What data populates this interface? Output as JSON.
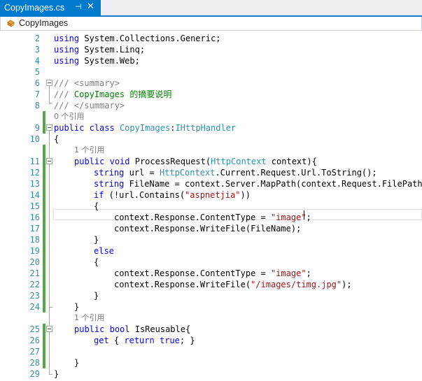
{
  "tab": {
    "title": "CopyImages.cs",
    "pin_icon": "pin-icon",
    "close_icon": "close-icon"
  },
  "navbar": {
    "selected": "CopyImages",
    "icon": "class-icon"
  },
  "colors": {
    "keyword": "#0000ff",
    "type": "#2b91af",
    "string": "#a31515",
    "comment": "#008000",
    "line_number": "#2b91af",
    "accent": "#007acc",
    "change_bar": "#57a64a"
  },
  "code": {
    "l2": {
      "n": "2",
      "kw": "using",
      "rest": " System.Collections.Generic;"
    },
    "l3": {
      "n": "3",
      "kw": "using",
      "rest": " System.Linq;"
    },
    "l4": {
      "n": "4",
      "kw": "using",
      "rest": " System.Web;"
    },
    "l5": {
      "n": "5"
    },
    "l6": {
      "n": "6",
      "c1": "///",
      "c2": " <summary>"
    },
    "l7": {
      "n": "7",
      "c1": "///",
      "c2": " CopyImages 的摘要说明"
    },
    "l8": {
      "n": "8",
      "c1": "///",
      "c2": " </summary>"
    },
    "lens1": "0 个引用",
    "l9": {
      "n": "9",
      "kw1": "public",
      "kw2": "class",
      "ty1": "CopyImages",
      "p1": ":",
      "ty2": "IHttpHandler"
    },
    "l10": {
      "n": "10",
      "text": "{"
    },
    "lens2": "1 个引用",
    "l11": {
      "n": "11",
      "kw1": "public",
      "kw2": "void",
      "p1": " ProcessRequest(",
      "ty1": "HttpContext",
      "p2": " context){"
    },
    "l12": {
      "n": "12",
      "kw1": "string",
      "p1": " url = ",
      "ty1": "HttpContext",
      "p2": ".Current.Request.Url.ToString();"
    },
    "l13": {
      "n": "13",
      "kw1": "string",
      "p1": " FileName = context.Server.MapPath(context.Request.FilePath);"
    },
    "l14": {
      "n": "14",
      "kw1": "if",
      "p1": " (!url.Contains(",
      "s1": "\"aspnetjia\"",
      "p2": "))"
    },
    "l15": {
      "n": "15",
      "text": "{"
    },
    "l16": {
      "n": "16",
      "p1": "context.Response.ContentType = ",
      "s1": "\"image\"",
      "p2": ";"
    },
    "l17": {
      "n": "17",
      "text": "context.Response.WriteFile(FileName);"
    },
    "l18": {
      "n": "18",
      "text": "}"
    },
    "l19": {
      "n": "19",
      "kw1": "else"
    },
    "l20": {
      "n": "20",
      "text": "{"
    },
    "l21": {
      "n": "21",
      "p1": "context.Response.ContentType = ",
      "s1": "\"image\"",
      "p2": ";"
    },
    "l22": {
      "n": "22",
      "p1": "context.Response.WriteFile(",
      "s1": "\"/images/timg.jpg\"",
      "p2": ");"
    },
    "l23": {
      "n": "23",
      "text": "}"
    },
    "l24": {
      "n": "24",
      "text": "}"
    },
    "lens3": "1 个引用",
    "l25": {
      "n": "25",
      "kw1": "public",
      "kw2": "bool",
      "p1": " IsReusable{"
    },
    "l26": {
      "n": "26",
      "kw1": "get",
      "p1": " { ",
      "kw2": "return",
      "kw3": "true",
      "p2": "; }"
    },
    "l27": {
      "n": "27"
    },
    "l28": {
      "n": "28",
      "text": "}"
    },
    "l29": {
      "n": "29",
      "text": "}"
    }
  }
}
